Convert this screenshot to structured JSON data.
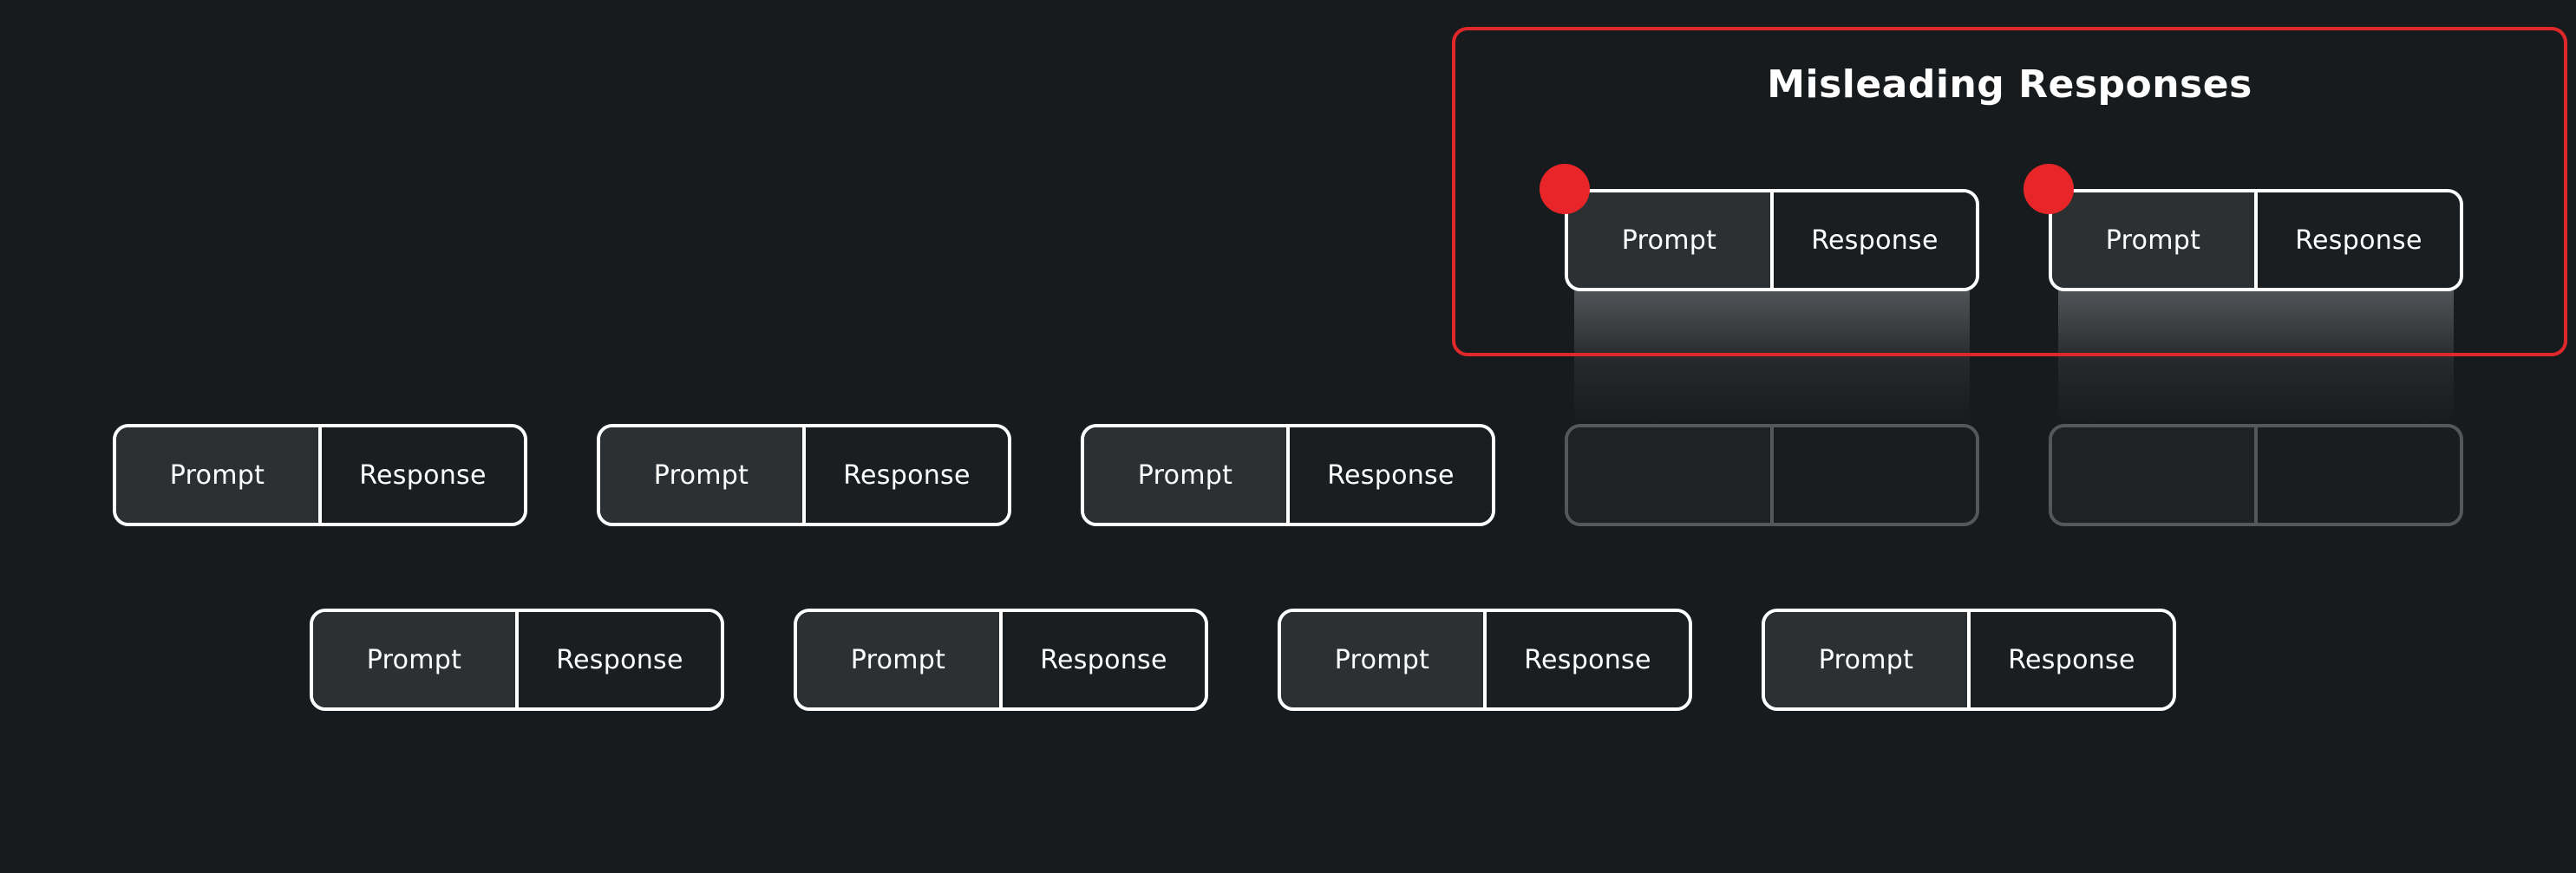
{
  "highlight": {
    "title": "Misleading Responses"
  },
  "labels": {
    "prompt": "Prompt",
    "response": "Response"
  },
  "colors": {
    "background": "#181b1e",
    "accent_red": "#e0272a",
    "card_border": "#ffffff",
    "prompt_fill": "#2d3033",
    "ghost_border": "#55585b"
  },
  "pairs": [
    {
      "row": "highlighted",
      "flagged": true,
      "label_prompt": "Prompt",
      "label_response": "Response"
    },
    {
      "row": "highlighted",
      "flagged": true,
      "label_prompt": "Prompt",
      "label_response": "Response"
    },
    {
      "row": "middle",
      "flagged": false,
      "label_prompt": "Prompt",
      "label_response": "Response"
    },
    {
      "row": "middle",
      "flagged": false,
      "label_prompt": "Prompt",
      "label_response": "Response"
    },
    {
      "row": "middle",
      "flagged": false,
      "label_prompt": "Prompt",
      "label_response": "Response"
    },
    {
      "row": "middle",
      "flagged": false,
      "empty": true
    },
    {
      "row": "middle",
      "flagged": false,
      "empty": true
    },
    {
      "row": "bottom",
      "flagged": false,
      "label_prompt": "Prompt",
      "label_response": "Response"
    },
    {
      "row": "bottom",
      "flagged": false,
      "label_prompt": "Prompt",
      "label_response": "Response"
    },
    {
      "row": "bottom",
      "flagged": false,
      "label_prompt": "Prompt",
      "label_response": "Response"
    },
    {
      "row": "bottom",
      "flagged": false,
      "label_prompt": "Prompt",
      "label_response": "Response"
    }
  ]
}
